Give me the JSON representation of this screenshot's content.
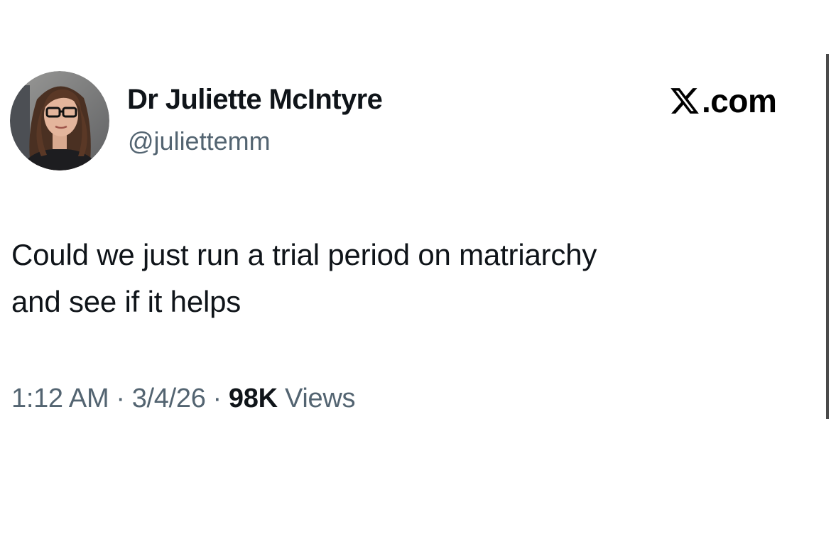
{
  "author": {
    "display_name": "Dr Juliette McIntyre",
    "handle": "@juliettemm",
    "avatar_icon": "profile-photo"
  },
  "brand": {
    "icon": "x-logo-icon",
    "domain": ".com"
  },
  "tweet": {
    "line1": "Could we just run a trial period on matriarchy",
    "line2": "and see if it helps"
  },
  "meta": {
    "time": "1:12 AM",
    "separator": "·",
    "date": "3/4/26",
    "views_count": "98K",
    "views_label": "Views"
  },
  "colors": {
    "primary_text": "#0f1419",
    "secondary_text": "#536471",
    "background": "#ffffff"
  }
}
